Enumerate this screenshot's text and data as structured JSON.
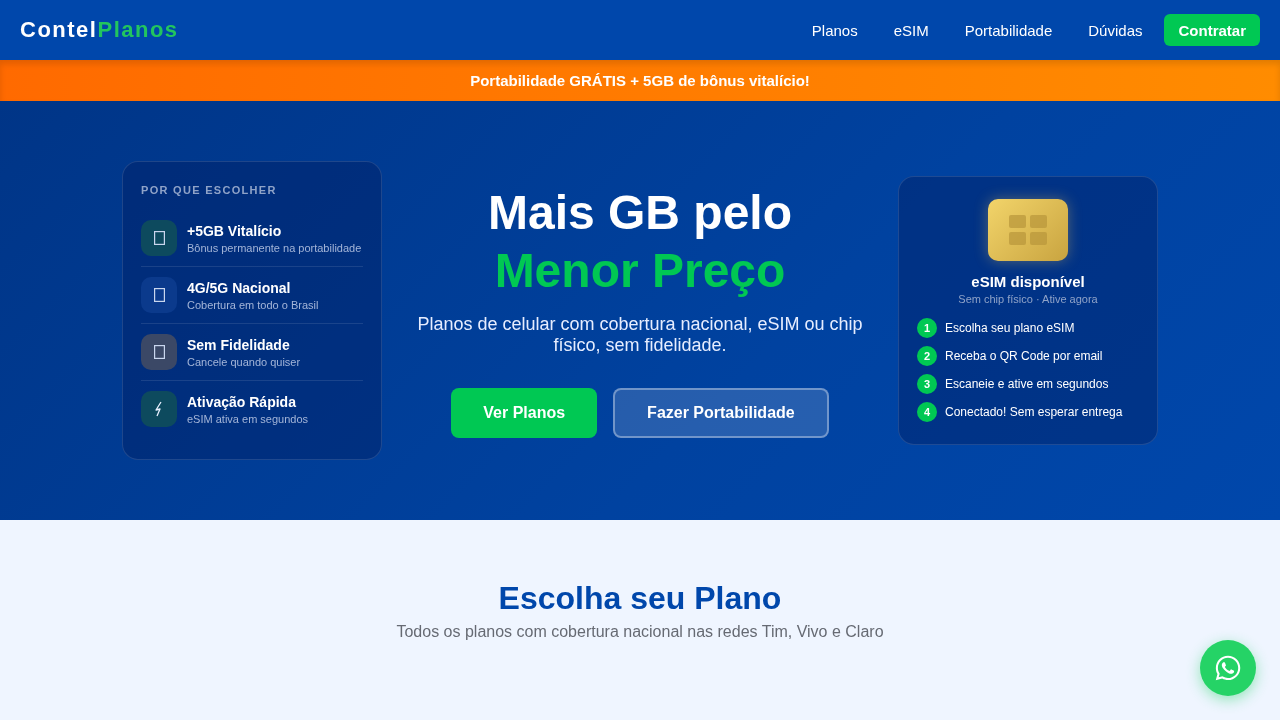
{
  "nav": {
    "logo": {
      "first": "Contel",
      "second": "Planos"
    },
    "links": [
      {
        "label": "Planos"
      },
      {
        "label": "eSIM"
      },
      {
        "label": "Portabilidade"
      },
      {
        "label": "Dúvidas"
      }
    ],
    "cta": "Contratar"
  },
  "promo_banner": "Portabilidade GRÁTIS + 5GB de bônus vitalício!",
  "hero": {
    "features_card": {
      "title": "POR QUE ESCOLHER",
      "items": [
        {
          "kind": "plain",
          "color": "#0d4a5e",
          "title": "+5GB Vitalício",
          "subtitle": "Bônus permanente na portabilidade"
        },
        {
          "kind": "plain",
          "color": "#0b3a8c",
          "title": "4G/5G Nacional",
          "subtitle": "Cobertura em todo o Brasil"
        },
        {
          "kind": "plain",
          "color": "#3b4866",
          "title": "Sem Fidelidade",
          "subtitle": "Cancele quando quiser"
        },
        {
          "kind": "bolt",
          "color": "#0d4a5e",
          "title": "Ativação Rápida",
          "subtitle": "eSIM ativa em segundos"
        }
      ]
    },
    "headline": "Mais GB pelo",
    "headline_highlight": "Menor Preço",
    "description": "Planos de celular com cobertura nacional, eSIM ou chip físico, sem fidelidade.",
    "buttons": [
      {
        "kind": "primary",
        "label": "Ver Planos"
      },
      {
        "kind": "outline",
        "label": "Fazer Portabilidade"
      }
    ],
    "esim_card": {
      "title": "eSIM disponível",
      "subtitle": "Sem chip físico · Ative agora",
      "steps": [
        {
          "number": "1",
          "text": "Escolha seu plano eSIM"
        },
        {
          "number": "2",
          "text": "Receba o QR Code por email"
        },
        {
          "number": "3",
          "text": "Escaneie e ative em segundos"
        },
        {
          "number": "4",
          "text": "Conectado! Sem esperar entrega"
        }
      ]
    }
  },
  "plans_section": {
    "title": "Escolha seu Plano",
    "subtitle": "Todos os planos com cobertura nacional nas redes Tim, Vivo e Claro"
  }
}
